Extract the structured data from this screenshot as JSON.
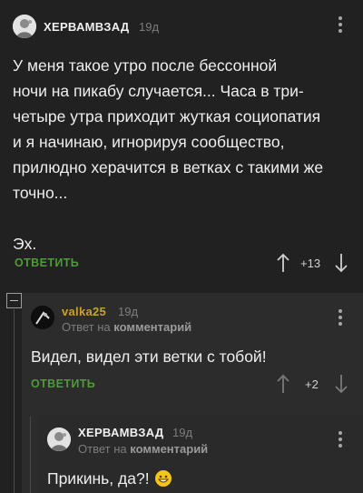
{
  "comments": [
    {
      "username": "ХЕРВАМВЗАД",
      "time": "19д",
      "text_lines": [
        "У меня такое утро после бессонной",
        "ночи на пикабу случается... Часа в три-",
        "четыре утра приходит жуткая социопатия",
        "и я начинаю, игнорируя сообщество,",
        "прилюдно херачится в ветках с такими же",
        "точно...",
        "",
        "Эх."
      ],
      "reply_label": "ОТВЕТИТЬ",
      "score": "+13"
    },
    {
      "username": "valka25",
      "time": "19д",
      "reply_to_prefix": "Ответ на",
      "reply_to_link": "комментарий",
      "text": "Видел, видел эти ветки с тобой!",
      "reply_label": "ОТВЕТИТЬ",
      "score": "+2"
    },
    {
      "username": "ХЕРВАМВЗАД",
      "time": "19д",
      "reply_to_prefix": "Ответ на",
      "reply_to_link": "комментарий",
      "text": "Прикинь, да?!",
      "emoji": "grinning-face-icon"
    }
  ],
  "colors": {
    "background": "#212121",
    "nested_background": "#2c2c2c",
    "reply_green": "#4f9a3a",
    "username_valka": "#c9a227"
  }
}
